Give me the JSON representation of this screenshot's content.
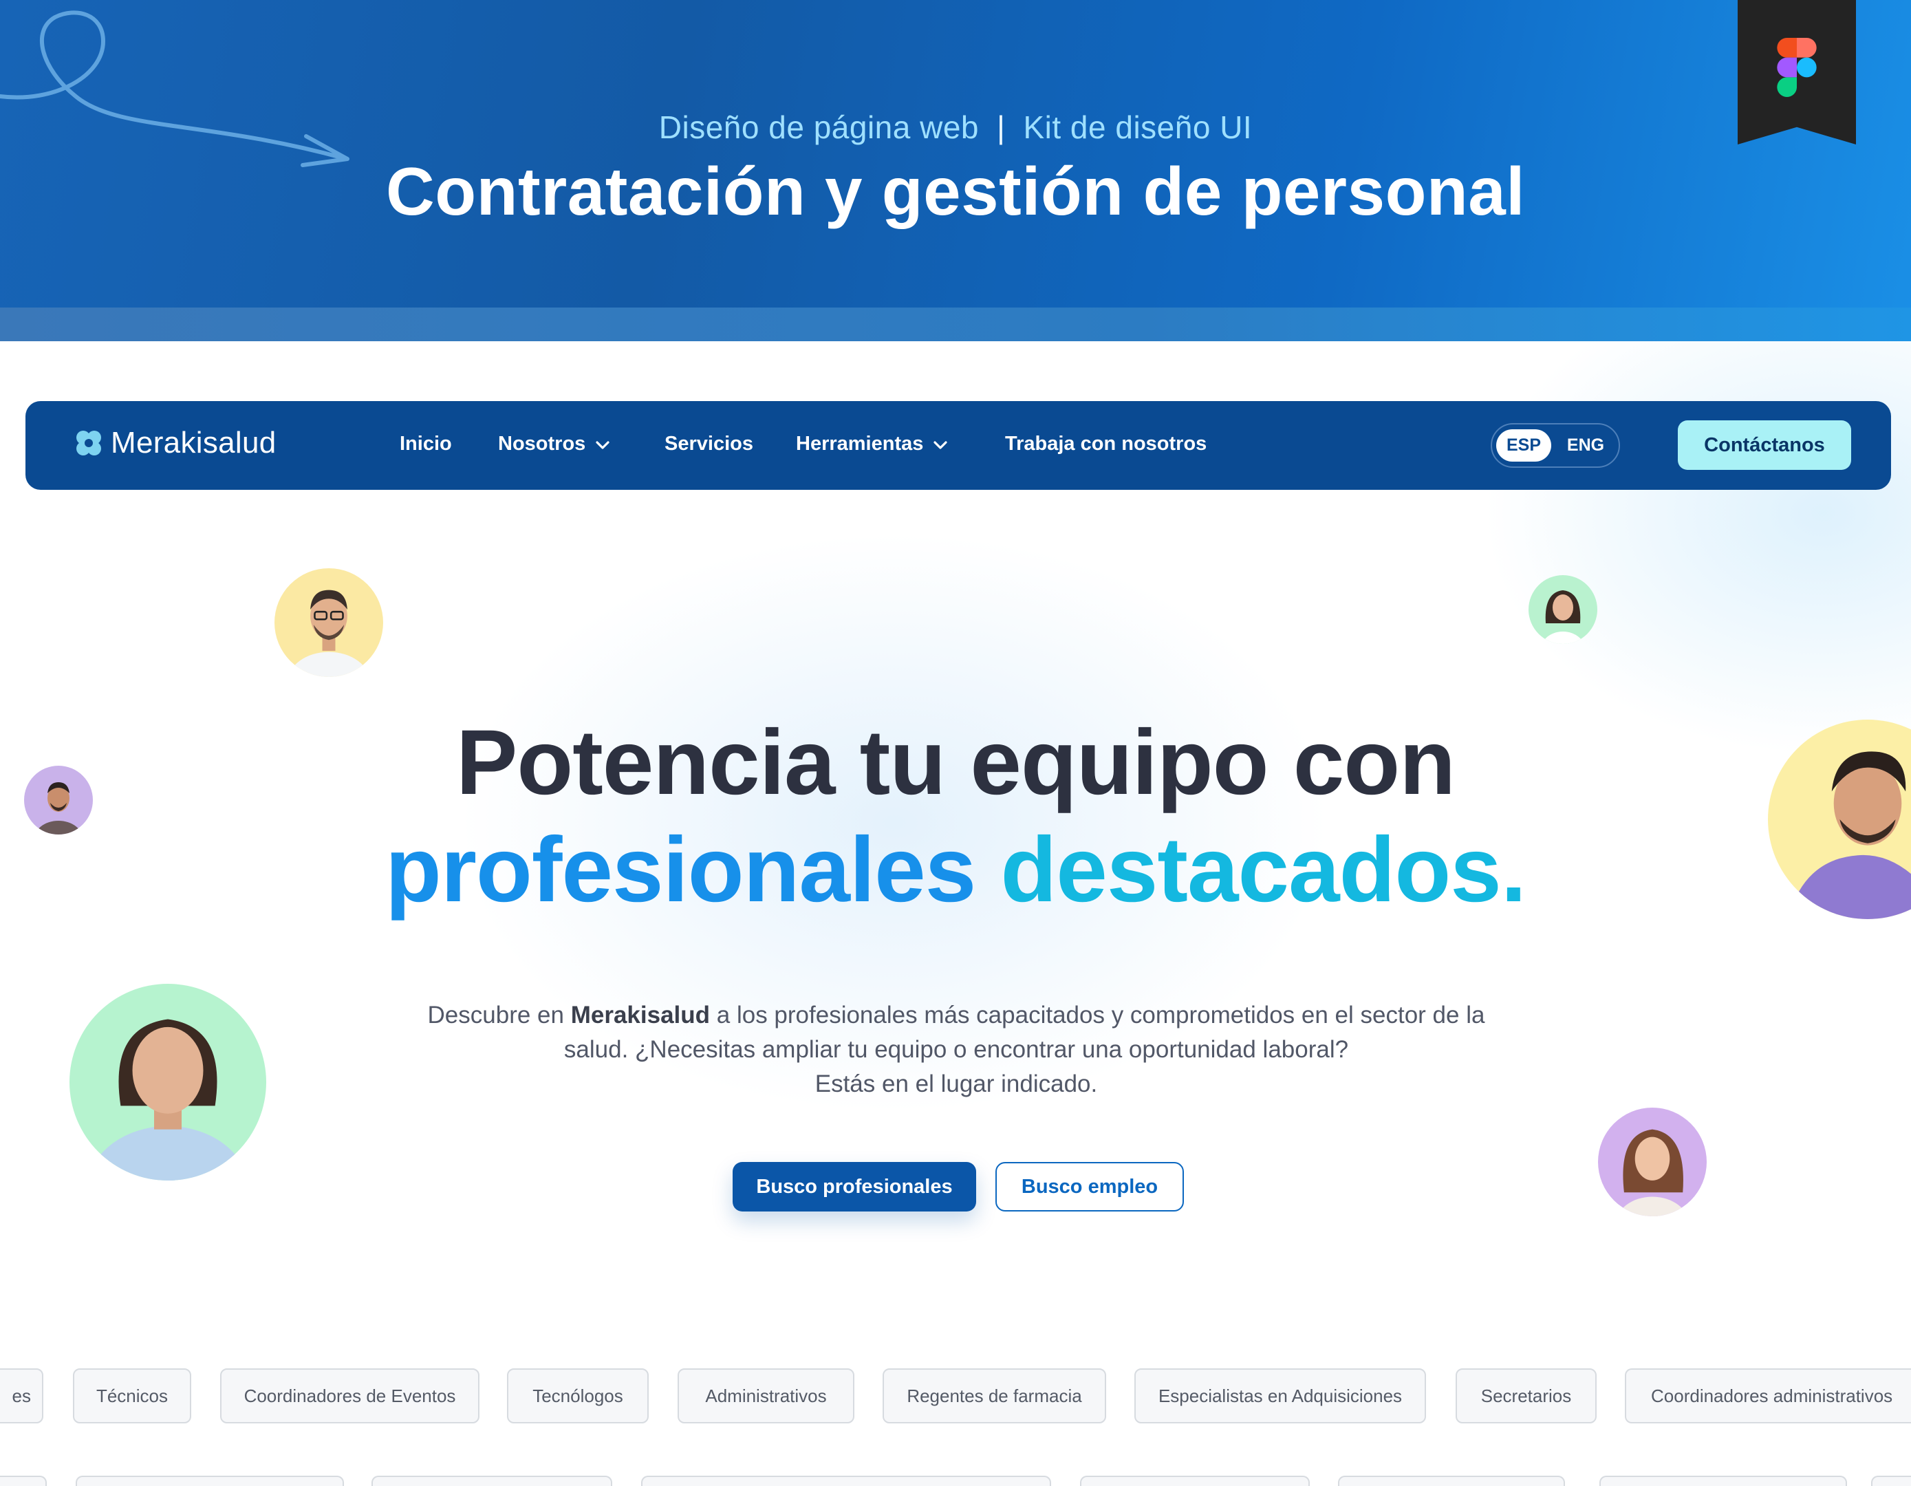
{
  "banner": {
    "subtitle_left": "Diseño de página web",
    "subtitle_sep": "|",
    "subtitle_right": "Kit de diseño UI",
    "title": "Contratación y gestión de personal",
    "ribbon_icon": "figma-icon"
  },
  "navbar": {
    "brand": "Merakisalud",
    "brand_icon": "clover-icon",
    "items": [
      {
        "label": "Inicio",
        "has_dropdown": false
      },
      {
        "label": "Nosotros",
        "has_dropdown": true
      },
      {
        "label": "Servicios",
        "has_dropdown": false
      },
      {
        "label": "Herramientas",
        "has_dropdown": true
      },
      {
        "label": "Trabaja con nosotros",
        "has_dropdown": false
      }
    ],
    "lang": {
      "active": "ESP",
      "other": "ENG"
    },
    "cta": "Contáctanos"
  },
  "hero": {
    "line1": "Potencia tu equipo con",
    "line2_a": "profesionales",
    "line2_b": "destacados.",
    "desc_pre": "Descubre en",
    "desc_brand": "Merakisalud",
    "desc_post": "a los profesionales más capacitados y comprometidos en el sector de la salud. ¿Necesitas ampliar tu equipo o encontrar una oportunidad laboral?",
    "desc_line3": "Estás en el lugar indicado.",
    "btn_primary": "Busco profesionales",
    "btn_secondary": "Busco empleo"
  },
  "chips": [
    "es",
    "Técnicos",
    "Coordinadores de Eventos",
    "Tecnólogos",
    "Administrativos",
    "Regentes de farmacia",
    "Especialistas en Adquisiciones",
    "Secretarios",
    "Coordinadores administrativos"
  ],
  "colors": {
    "navy": "#0a4a92",
    "accent_blue": "#1790ea",
    "accent_cyan": "#14b8e0",
    "cta_mint": "#a9f1f6",
    "heading_dark": "#2d3140"
  }
}
